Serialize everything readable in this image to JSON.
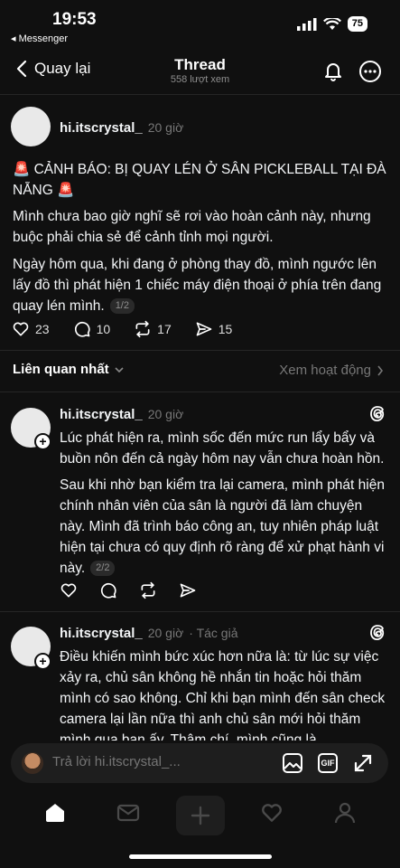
{
  "status_bar": {
    "time": "19:53",
    "back_app": "◂ Messenger",
    "battery": "75"
  },
  "header": {
    "back_label": "Quay lại",
    "title": "Thread",
    "views": "558 lượt xem"
  },
  "main_post": {
    "username": "hi.itscrystal_",
    "time": "20 giờ",
    "paragraphs": [
      "🚨 CẢNH BÁO: BỊ QUAY LÉN Ở SÂN PICKLEBALL TẠI ĐÀ NẴNG 🚨",
      "Mình chưa bao giờ nghĩ sẽ rơi vào hoàn cảnh này, nhưng buộc phải chia sẻ để cảnh tỉnh mọi người.",
      "Ngày hôm qua, khi đang ở phòng thay đồ, mình ngước lên lấy đồ thì phát hiện 1 chiếc máy điện thoại ở phía trên đang quay lén mình."
    ],
    "pager": "1/2",
    "likes": "23",
    "comments": "10",
    "reposts": "17",
    "shares": "15"
  },
  "sort": {
    "left_label": "Liên quan nhất",
    "right_label": "Xem hoạt động"
  },
  "reply1": {
    "username": "hi.itscrystal_",
    "time": "20 giờ",
    "paragraphs": [
      "Lúc phát hiện ra, mình sốc đến mức run lẩy bẩy và buồn nôn đến cả ngày hôm nay vẫn chưa hoàn hồn.",
      "Sau khi nhờ bạn kiểm tra lại camera, mình phát hiện chính nhân viên của sân là người đã làm chuyện này. Mình đã trình báo công an, tuy nhiên pháp luật hiện tại chưa có quy định rõ ràng để xử phạt hành vi này."
    ],
    "pager": "2/2"
  },
  "reply2": {
    "username": "hi.itscrystal_",
    "time": "20 giờ",
    "author_tag": "· Tác giả",
    "text": "Điều khiến mình bức xúc hơn nữa là: từ lúc sự việc xảy ra, chủ sân không hề nhắn tin hoặc hỏi thăm mình có sao không. Chỉ khi bạn mình đến sân check camera lại lần nữa thì anh chủ sân mới hỏi thăm mình qua bạn ấy. Thậm chí, mình cũng là"
  },
  "reply_bar": {
    "placeholder": "Trả lời hi.itscrystal_...",
    "gif_label": "GIF"
  },
  "icons": [
    "chevron-left-icon",
    "bell-icon",
    "more-icon",
    "heart-icon",
    "comment-icon",
    "repost-icon",
    "share-icon",
    "threads-icon",
    "image-icon",
    "expand-icon",
    "home-icon",
    "inbox-icon",
    "plus-icon",
    "person-icon"
  ]
}
